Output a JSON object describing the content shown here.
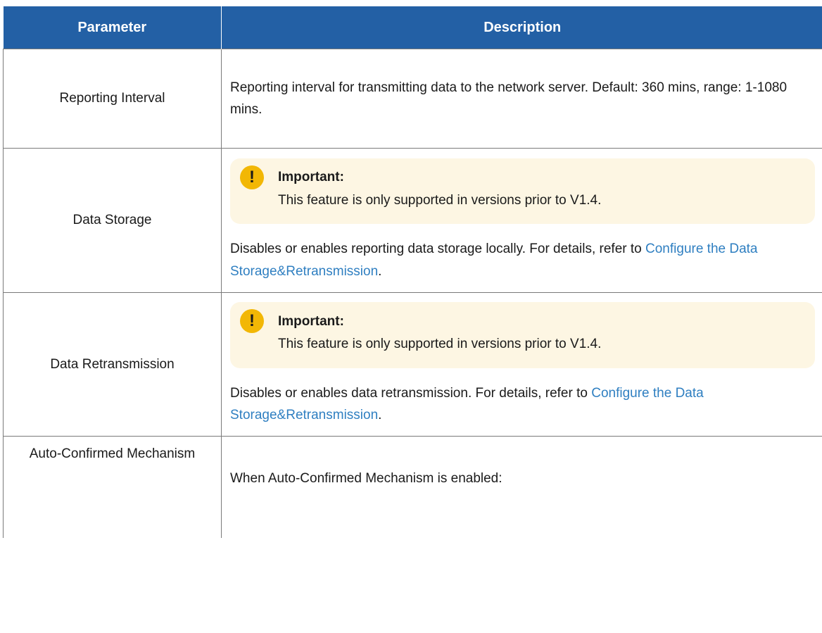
{
  "table": {
    "headers": {
      "parameter": "Parameter",
      "description": "Description"
    },
    "rows": {
      "reporting_interval": {
        "name": "Reporting Interval",
        "description": "Reporting interval for transmitting data to the network server. Default: 360 mins, range: 1-1080 mins."
      },
      "data_storage": {
        "name": "Data Storage",
        "note_title": "Important:",
        "note_body": "This feature is only supported in versions prior to V1.4.",
        "description_prefix": "Disables or enables reporting data storage locally. For details, refer to ",
        "link_text": "Configure the Data Storage&Retransmission",
        "description_suffix": "."
      },
      "data_retransmission": {
        "name": "Data Retransmission",
        "note_title": "Important:",
        "note_body": "This feature is only supported in versions prior to V1.4.",
        "description_prefix": "Disables or enables data retransmission. For details, refer to ",
        "link_text": "Configure the Data Storage&Retransmission",
        "description_suffix": "."
      },
      "auto_confirmed": {
        "name": "Auto-Confirmed Mechanism",
        "description": "When Auto-Confirmed Mechanism is enabled:"
      }
    }
  },
  "icons": {
    "important": "exclamation-icon",
    "important_glyph": "!"
  },
  "colors": {
    "header_bg": "#2360a5",
    "note_bg": "#fdf6e3",
    "icon": "#f2b705",
    "link": "#2f7fc1"
  }
}
